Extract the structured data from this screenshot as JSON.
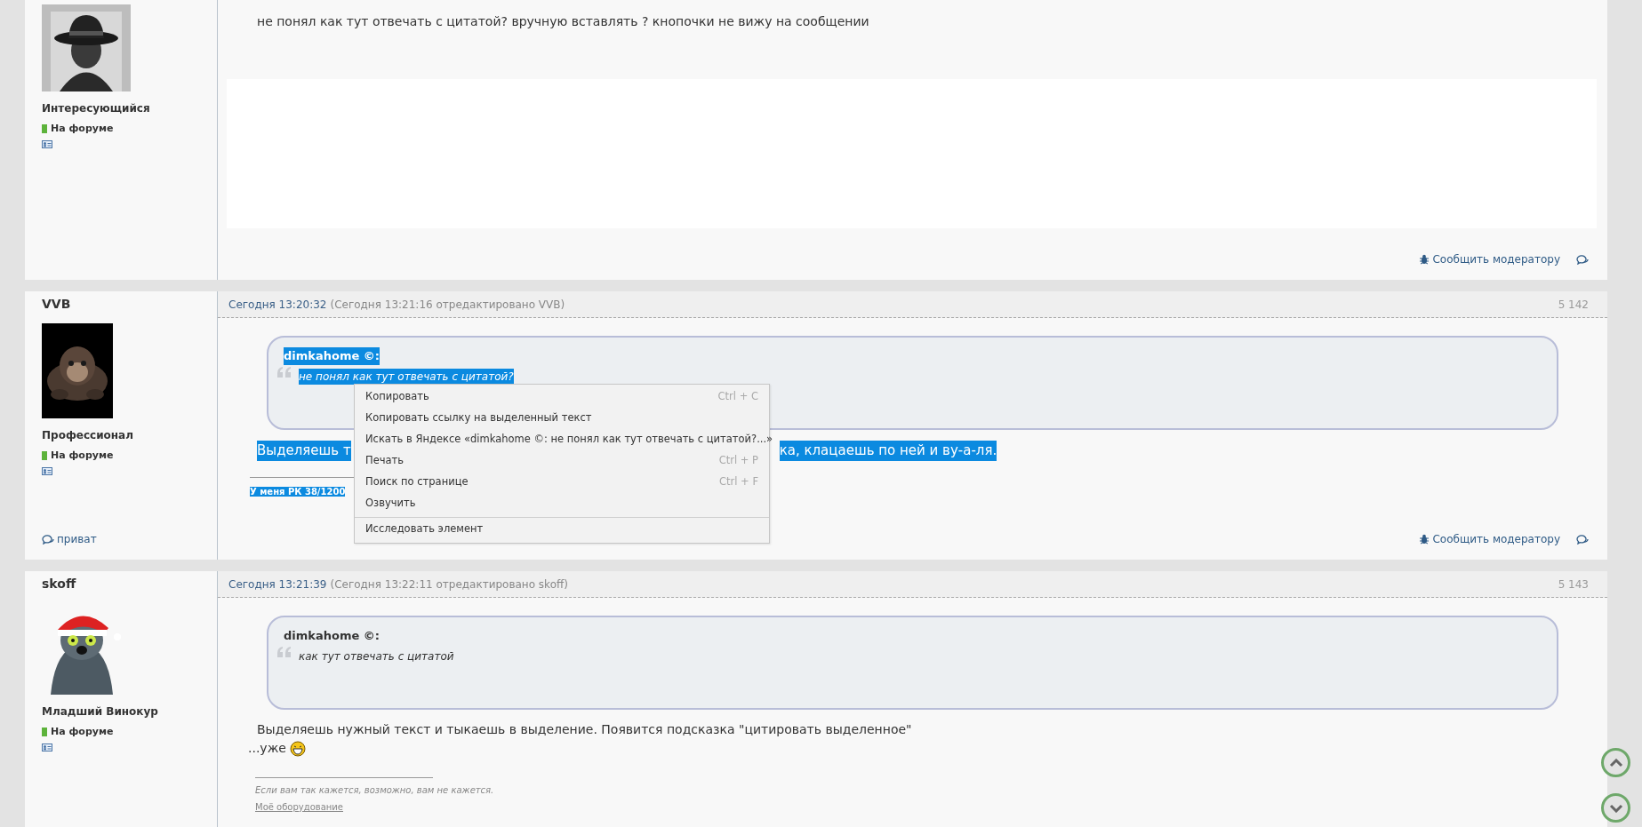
{
  "posts": [
    {
      "kind": "top",
      "rank": "Интересующийся",
      "online": "На форуме",
      "body_lines": [
        "не понял как тут отвечать с цитатой? вручную вставлять ? кнопочки не вижу на сообщении"
      ],
      "report": "Сообщить модератору"
    },
    {
      "kind": "full",
      "author": "VVB",
      "date": "Сегодня 13:20:32",
      "edited": "(Сегодня 13:21:16 отредактировано VVB)",
      "number": "5 142",
      "rank": "Профессионал",
      "online": "На форуме",
      "selected": true,
      "quote": {
        "author": "dimkahome ©:",
        "text": "не понял как тут отвечать с цитатой?"
      },
      "body_parts": [
        "Выделяешь т",
        "ка, клацаешь по ней и ву-а-ля."
      ],
      "signature": "У меня РК 38/1200",
      "private": "приват",
      "report": "Сообщить модератору"
    },
    {
      "kind": "full",
      "author": "skoff",
      "date": "Сегодня 13:21:39",
      "edited": "(Сегодня 13:22:11 отредактировано skoff)",
      "number": "5 143",
      "rank": "Младший Винокур",
      "online": "На форуме",
      "selected": false,
      "quote": {
        "author": "dimkahome ©:",
        "text": "как тут отвечать с цитатой"
      },
      "body_lines": [
        "Выделяешь нужный текст и тыкаешь в выделение. Появится подсказка \"цитировать выделенное\"",
        "...уже"
      ],
      "signature_note": "Если вам так кажется, возможно, вам не кажется.",
      "signature_link": "Моё оборудование"
    }
  ],
  "context_menu": [
    {
      "label": "Копировать",
      "shortcut": "Ctrl + C",
      "divider_before": false
    },
    {
      "label": "Копировать ссылку на выделенный текст",
      "divider_before": false
    },
    {
      "label": "Искать в Яндексе «dimkahome ©: не понял как тут отвечать с цитатой?...»",
      "divider_before": false
    },
    {
      "label": "Печать",
      "shortcut": "Ctrl + P",
      "divider_before": false
    },
    {
      "label": "Поиск по странице",
      "shortcut": "Ctrl + F",
      "divider_before": false
    },
    {
      "label": "Озвучить",
      "divider_before": false
    },
    {
      "label": "Исследовать элемент",
      "divider_before": true
    }
  ]
}
